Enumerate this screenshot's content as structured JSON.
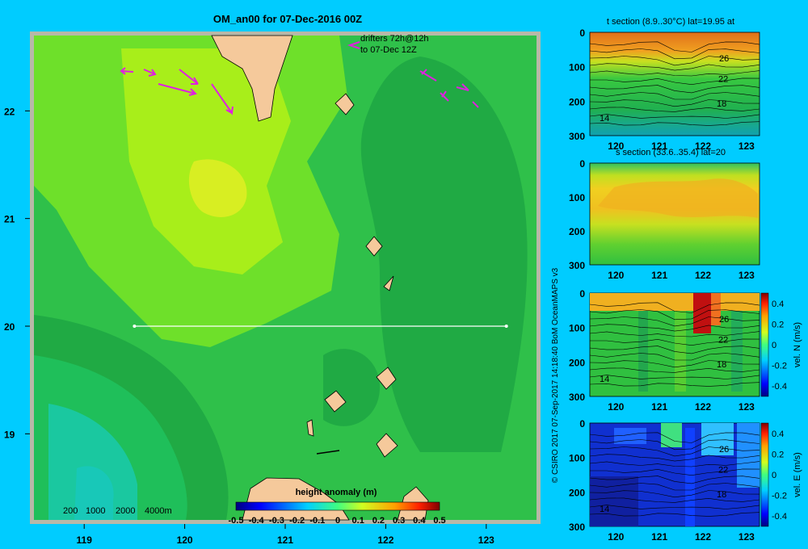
{
  "chart_data": [
    {
      "type": "heatmap",
      "title": "OM_an00 for 07-Dec-2016 00Z",
      "xticks": [
        "119",
        "120",
        "121",
        "122",
        "123"
      ],
      "yticks": [
        "22",
        "21",
        "20",
        "19"
      ],
      "xlim": [
        118.5,
        123.5
      ],
      "ylim": [
        18.2,
        22.7
      ],
      "section_line": {
        "lon1": 119.5,
        "lon2": 123.2,
        "lat": 20.0
      },
      "drifter_note": [
        "drifters 72h@12h",
        "to 07-Dec 12Z"
      ],
      "depth_legend": [
        "200",
        "1000",
        "2000",
        "4000m"
      ],
      "colorbar": {
        "label": "height anomaly (m)",
        "ticks": [
          "-0.5",
          "-0.4",
          "-0.3",
          "-0.2",
          "-0.1",
          "0",
          "0.1",
          "0.2",
          "0.3",
          "0.4",
          "0.5"
        ],
        "range": [
          -0.5,
          0.5
        ]
      },
      "field_levels": [
        {
          "value": 0.05,
          "color": "#1fbf5a"
        },
        {
          "value": 0.1,
          "color": "#2fc04a"
        },
        {
          "value": 0.15,
          "color": "#20aa44"
        },
        {
          "value": 0.2,
          "color": "#6ee02a"
        },
        {
          "value": 0.25,
          "color": "#a8ee1a"
        },
        {
          "value": 0.3,
          "color": "#c8f020"
        },
        {
          "value": 0.35,
          "color": "#d8ee22"
        }
      ]
    },
    {
      "type": "heatmap",
      "title": "t section (8.9..30°C) lat=19.95 at",
      "xticks": [
        "120",
        "121",
        "122",
        "123"
      ],
      "yticks": [
        "0",
        "100",
        "200",
        "300"
      ],
      "contour_labels": [
        "26",
        "22",
        "18",
        "14"
      ]
    },
    {
      "type": "heatmap",
      "title": "s section (33.6..35.4) lat=20",
      "xticks": [
        "120",
        "121",
        "122",
        "123"
      ],
      "yticks": [
        "0",
        "100",
        "200",
        "300"
      ]
    },
    {
      "type": "heatmap",
      "title": "",
      "xticks": [
        "120",
        "121",
        "122",
        "123"
      ],
      "yticks": [
        "0",
        "100",
        "200",
        "300"
      ],
      "contour_labels": [
        "26",
        "22",
        "18",
        "14"
      ],
      "colorbar": {
        "label": "vel. N (m/s)",
        "ticks": [
          "0.4",
          "0.2",
          "0",
          "-0.2",
          "-0.4"
        ],
        "range": [
          -0.5,
          0.5
        ]
      }
    },
    {
      "type": "heatmap",
      "title": "",
      "xticks": [
        "120",
        "121",
        "122",
        "123"
      ],
      "yticks": [
        "0",
        "100",
        "200",
        "300"
      ],
      "contour_labels": [
        "26",
        "22",
        "18",
        "14"
      ],
      "colorbar": {
        "label": "vel. E (m/s)",
        "ticks": [
          "0.4",
          "0.2",
          "0",
          "-0.2",
          "-0.4"
        ],
        "range": [
          -0.5,
          0.5
        ]
      }
    }
  ],
  "credit": "© CSIRO 2017   07-Sep-2017 14:18:40 BoM OceanMAPS v3",
  "colors": {
    "background": "#00ccff",
    "land": "#f5c99b",
    "frame": "#b8b8a8",
    "drifter": "#e020e0"
  }
}
